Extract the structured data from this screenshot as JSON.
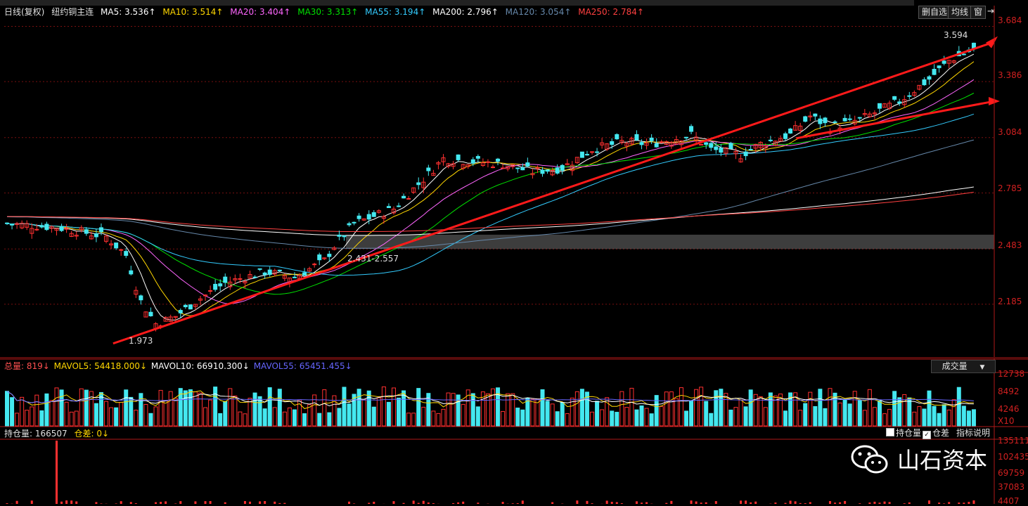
{
  "legend_main": {
    "period": "日线(复权)",
    "contract": "纽约铜主连",
    "ma": [
      {
        "label": "MA5: 3.536↑",
        "color": "#ffffff"
      },
      {
        "label": "MA10: 3.514↑",
        "color": "#ffd700"
      },
      {
        "label": "MA20: 3.404↑",
        "color": "#ff66ff"
      },
      {
        "label": "MA30: 3.313↑",
        "color": "#00e000"
      },
      {
        "label": "MA55: 3.194↑",
        "color": "#33ccff"
      },
      {
        "label": "MA200: 2.796↑",
        "color": "#ffffff"
      },
      {
        "label": "MA120: 3.054↑",
        "color": "#6688aa"
      },
      {
        "label": "MA250: 2.784↑",
        "color": "#ff4040"
      }
    ]
  },
  "buttons": {
    "delete_self": "删自选",
    "ma": "均线",
    "window": "窗"
  },
  "legend_vol": {
    "total": "总量: 819↓",
    "mavol5": "MAVOL5: 54418.000↓",
    "mavol10": "MAVOL10: 66910.300↓",
    "mavol55": "MAVOL55: 65451.455↓",
    "colors": {
      "total": "#ff5050",
      "mavol5": "#ffd700",
      "mavol10": "#ffffff",
      "mavol55": "#6666ff"
    }
  },
  "vol_select": "成交量",
  "legend_oi": {
    "oi": "持仓量: 166507",
    "diff": "仓差: 0↓"
  },
  "oi_controls": {
    "hold": "持仓量",
    "diff": "仓差",
    "explain": "指标说明"
  },
  "watermark": "山石资本",
  "chart_data": [
    {
      "type": "candlestick",
      "name": "纽约铜主连 日线(复权)",
      "y_ticks": [
        3.684,
        3.386,
        3.084,
        2.785,
        2.483,
        2.185
      ],
      "ylim": [
        1.9,
        3.72
      ],
      "annotations": [
        {
          "label": "1.973",
          "value": 1.973
        },
        {
          "label": "2.431-2.557",
          "range": [
            2.431,
            2.557
          ]
        },
        {
          "label": "3.594",
          "value": 3.594
        }
      ],
      "shaded_zone": [
        2.483,
        2.56
      ],
      "trendlines": [
        {
          "from": [
            0.11,
            1.973
          ],
          "to": [
            1.0,
            3.6
          ]
        },
        {
          "from": [
            0.8,
            3.08
          ],
          "to": [
            1.0,
            3.28
          ]
        }
      ],
      "ma_latest": {
        "MA5": 3.536,
        "MA10": 3.514,
        "MA20": 3.404,
        "MA30": 3.313,
        "MA55": 3.194,
        "MA120": 3.054,
        "MA200": 2.796,
        "MA250": 2.784
      }
    },
    {
      "type": "bar",
      "name": "成交量",
      "y_ticks": [
        "12738",
        "8492",
        "4246",
        "X10"
      ],
      "ylim": [
        0,
        14000
      ]
    },
    {
      "type": "bar",
      "name": "持仓量",
      "y_ticks": [
        "135111",
        "102435",
        "69759",
        "37083",
        "4407"
      ]
    }
  ],
  "colors": {
    "up": "#ff3030",
    "down": "#44e8f0",
    "grid": "#7a1010",
    "axis": "#b01818",
    "trend": "#ff1a1a"
  }
}
